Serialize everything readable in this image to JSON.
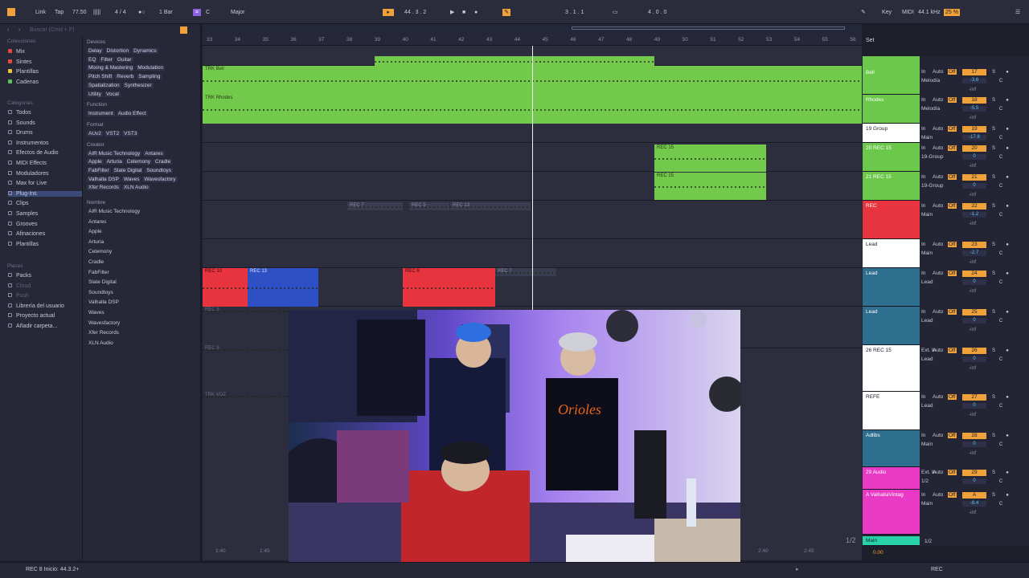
{
  "toolbar": {
    "link": "Link",
    "tap": "Tap",
    "tempo": "77.50",
    "signature": "4 / 4",
    "quantize": "1 Bar",
    "key": "C",
    "scale": "Major",
    "position": "44 .  3 .  2",
    "loop_start": "3 .  1 .  1",
    "loop_length": "4 .  0 .  0",
    "key_label": "Key",
    "midi_label": "MIDI",
    "sample_rate": "44.1 kHz",
    "cpu": "25 %"
  },
  "browser": {
    "search_placeholder": "Buscar (Cmd + F)",
    "collections_header": "Colecciones",
    "collections": [
      {
        "label": "Mix",
        "color": "#e2483b"
      },
      {
        "label": "Sintes",
        "color": "#e2483b"
      },
      {
        "label": "Plantillas",
        "color": "#f0c33a"
      },
      {
        "label": "Cadenas",
        "color": "#58c35a"
      }
    ],
    "categories_header": "Categorías",
    "categories": [
      "Todos",
      "Sounds",
      "Drums",
      "Instrumentos",
      "Efectos de Audio",
      "MIDI Effects",
      "Moduladores",
      "Max for Live",
      "Plug-Ins",
      "Clips",
      "Samples",
      "Grooves",
      "Afinaciones",
      "Plantillas"
    ],
    "places_header": "Places",
    "places": [
      "Packs",
      "Cloud",
      "Push",
      "Librería del usuario",
      "Proyecto actual",
      "Añadir carpeta..."
    ],
    "filter_groups": [
      {
        "header": "Devices",
        "tags": [
          [
            "Delay",
            "Distortion",
            "Dynamics"
          ],
          [
            "EQ",
            "Filter",
            "Guitar"
          ],
          [
            "Mixing & Mastering",
            "Modulation"
          ],
          [
            "Pitch Shift",
            "Reverb",
            "Sampling"
          ],
          [
            "Spatialization",
            "Synthesizer"
          ],
          [
            "Utility",
            "Vocal"
          ]
        ]
      },
      {
        "header": "Function",
        "tags": [
          [
            "Instrument",
            "Audio Effect"
          ]
        ]
      },
      {
        "header": "Format",
        "tags": [
          [
            "AUv2",
            "VST2",
            "VST3"
          ]
        ]
      },
      {
        "header": "Creator",
        "tags": [
          [
            "AIR Music Technology",
            "Antares"
          ],
          [
            "Apple",
            "Arturia",
            "Celemony",
            "Cradle"
          ],
          [
            "FabFilter",
            "Slate Digital",
            "Soundtoys"
          ],
          [
            "Valhalla DSP",
            "Waves",
            "Wavesfactory"
          ],
          [
            "Xfer Records",
            "XLN Audio"
          ]
        ]
      }
    ],
    "name_header": "Nombre",
    "plugins": [
      "AIR Music Technology",
      "Antares",
      "Apple",
      "Arturia",
      "Celemony",
      "Cradle",
      "FabFilter",
      "Slate Digital",
      "Soundtoys",
      "Valhalla DSP",
      "Waves",
      "Wavesfactory",
      "Xfer Records",
      "XLN Audio"
    ]
  },
  "ruler": [
    "33",
    "34",
    "35",
    "36",
    "37",
    "38",
    "39",
    "40",
    "41",
    "42",
    "43",
    "44",
    "45",
    "46",
    "47",
    "48",
    "49",
    "50",
    "51",
    "52",
    "53",
    "54",
    "55",
    "56"
  ],
  "clips": {
    "bell": "TRK Bell",
    "rhodes": "TRK Rhodes",
    "rec15a": "REC 15",
    "rec15b": "REC 15",
    "rec7": "REC 7",
    "rec5": "REC 5",
    "rec13a": "REC 13",
    "rec10": "REC 10",
    "rec13b": "REC 13",
    "rec6": "REC 6",
    "rec7b": "REC 7",
    "rec8": "REC 8",
    "rec8b": "REC 8",
    "trkvoz": "TRK VOZ"
  },
  "tracks": [
    {
      "name": "Bell",
      "color": "#6cc84a",
      "num": "17",
      "input": "Melodía",
      "vol": "-3.6"
    },
    {
      "name": "Rhodes",
      "color": "#6cc84a",
      "num": "18",
      "input": "Melodía",
      "vol": "-5.5"
    },
    {
      "name": "19 Group",
      "color": "#ffffff",
      "num": "19",
      "input": "Main",
      "vol": "-17.8"
    },
    {
      "name": "20 REC 15",
      "color": "#6cc84a",
      "num": "20",
      "input": "19-Group",
      "vol": "0"
    },
    {
      "name": "21 REC 15",
      "color": "#6cc84a",
      "num": "21",
      "input": "19-Group",
      "vol": "0"
    },
    {
      "name": "REC",
      "color": "#e8343f",
      "num": "22",
      "input": "Main",
      "vol": "-1.2"
    },
    {
      "name": "Lead",
      "color": "#ffffff",
      "num": "23",
      "input": "Main",
      "vol": "-2.7"
    },
    {
      "name": "Lead",
      "color": "#2e6e8f",
      "num": "24",
      "input": "Lead",
      "vol": "0"
    },
    {
      "name": "Lead",
      "color": "#2e6e8f",
      "num": "25",
      "input": "Lead",
      "vol": "0"
    },
    {
      "name": "26 REC 15",
      "color": "#ffffff",
      "num": "26",
      "input": "Lead",
      "vol": "0"
    },
    {
      "name": "REFE",
      "color": "#ffffff",
      "num": "27",
      "input": "Lead",
      "vol": "0"
    },
    {
      "name": "Adlibs",
      "color": "#2e6e8f",
      "num": "28",
      "input": "Main",
      "vol": "0"
    },
    {
      "name": "29 Audio",
      "color": "#e83ac4",
      "num": "29",
      "input": "1/2",
      "vol": "0"
    },
    {
      "name": "A ValhallaVintag",
      "color": "#e83ac4",
      "num": "A",
      "input": "Main",
      "vol": "-8.4"
    }
  ],
  "master": {
    "name": "Main",
    "io": "1/2",
    "vol": "0.00",
    "label": "1/2"
  },
  "labels": {
    "in": "In",
    "auto": "Auto",
    "off": "Off",
    "s": "S",
    "c": "C",
    "inf": "-inf",
    "set": "Set",
    "ext_in": "Ext. In"
  },
  "status": {
    "left": "REC 8  Inicio: 44.3.2+",
    "right_rec": "REC"
  },
  "video_caption": "ORIOLES 16",
  "timecodes": [
    "1:40",
    "1:45",
    "2:40",
    "2:45"
  ]
}
